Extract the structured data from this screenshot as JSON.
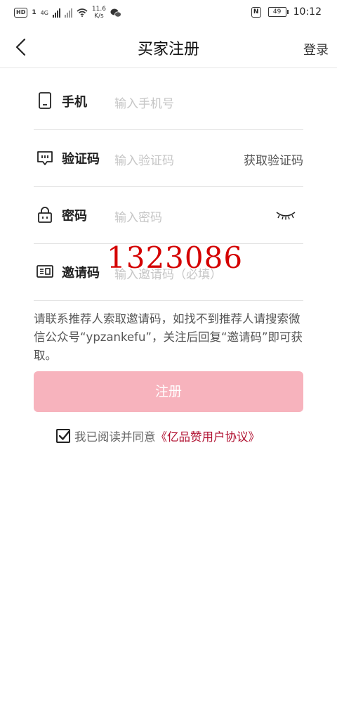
{
  "status_bar": {
    "hd": "HD",
    "sim": "1",
    "network": "4G",
    "speed_value": "11.6",
    "speed_unit": "K/s",
    "battery": "49",
    "time": "10:12"
  },
  "header": {
    "title": "买家注册",
    "login": "登录"
  },
  "form": {
    "phone": {
      "label": "手机",
      "placeholder": "输入手机号"
    },
    "code": {
      "label": "验证码",
      "placeholder": "输入验证码",
      "action": "获取验证码"
    },
    "password": {
      "label": "密码",
      "placeholder": "输入密码"
    },
    "invite": {
      "label": "邀请码",
      "placeholder": "输入邀请码（必填）"
    }
  },
  "watermark": "1323086",
  "hint": "请联系推荐人索取邀请码，如找不到推荐人请搜索微信公众号“ypzankefu”，关注后回复“邀请码”即可获取。",
  "submit": "注册",
  "agreement": {
    "text": "我已阅读并同意",
    "link": "《亿品赞用户协议》",
    "checked": true
  },
  "colors": {
    "accent": "#f7b3bd",
    "link": "#b01030",
    "watermark": "#d40000"
  }
}
